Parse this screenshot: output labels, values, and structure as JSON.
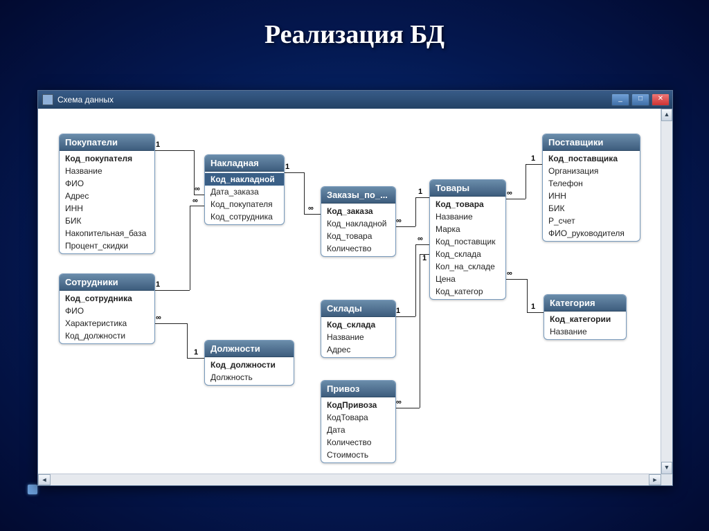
{
  "slide": {
    "title": "Реализация БД"
  },
  "window": {
    "title": "Схема данных",
    "buttons": {
      "min": "_",
      "max": "□",
      "close": "✕"
    },
    "scroll": {
      "up": "▲",
      "down": "▼",
      "left": "◄",
      "right": "►"
    }
  },
  "tables": {
    "pokupateli": {
      "title": "Покупатели",
      "fields": [
        "Код_покупателя",
        "Название",
        "ФИО",
        "Адрес",
        "ИНН",
        "БИК",
        "Накопительная_база",
        "Процент_скидки"
      ],
      "pk": [
        0
      ]
    },
    "sotrudniki": {
      "title": "Сотрудники",
      "fields": [
        "Код_сотрудника",
        "ФИО",
        "Характеристика",
        "Код_должности"
      ],
      "pk": [
        0
      ]
    },
    "nakladnaya": {
      "title": "Накладная",
      "fields": [
        "Код_накладной",
        "Дата_заказа",
        "Код_покупателя",
        "Код_сотрудника"
      ],
      "pk": [
        0
      ],
      "selected": [
        0
      ]
    },
    "dolzhnosti": {
      "title": "Должности",
      "fields": [
        "Код_должности",
        "Должность"
      ],
      "pk": [
        0
      ]
    },
    "zakazy": {
      "title": "Заказы_по_...",
      "fields": [
        "Код_заказа",
        "Код_накладной",
        "Код_товара",
        "Количество"
      ],
      "pk": [
        0
      ]
    },
    "sklady": {
      "title": "Склады",
      "fields": [
        "Код_склада",
        "Название",
        "Адрес"
      ],
      "pk": [
        0
      ]
    },
    "privoz": {
      "title": "Привоз",
      "fields": [
        "КодПривоза",
        "КодТовара",
        "Дата",
        "Количество",
        "Стоимость"
      ],
      "pk": [
        0
      ]
    },
    "tovary": {
      "title": "Товары",
      "fields": [
        "Код_товара",
        "Название",
        "Марка",
        "Код_поставщик",
        "Код_склада",
        "Кол_на_складе",
        "Цена",
        "Код_категор"
      ],
      "pk": [
        0
      ]
    },
    "postavshchiki": {
      "title": "Поставщики",
      "fields": [
        "Код_поставщика",
        "Организация",
        "Телефон",
        "ИНН",
        "БИК",
        "Р_счет",
        "ФИО_руководителя"
      ],
      "pk": [
        0
      ]
    },
    "kategoriya": {
      "title": "Категория",
      "fields": [
        "Код_категории",
        "Название"
      ],
      "pk": [
        0
      ]
    }
  },
  "labels": {
    "one": "1",
    "many": "∞"
  }
}
